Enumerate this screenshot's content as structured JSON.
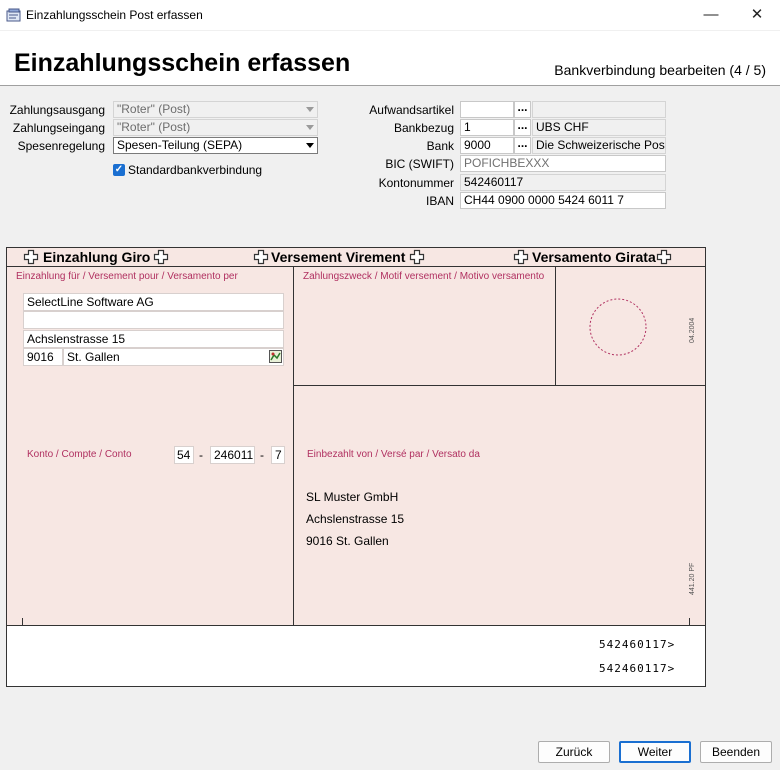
{
  "window": {
    "title": "Einzahlungsschein Post erfassen",
    "minimize": "—",
    "close": "✕"
  },
  "header": {
    "title": "Einzahlungsschein erfassen",
    "step": "Bankverbindung bearbeiten (4 / 5)"
  },
  "left_form": {
    "zahlungsausgang_label": "Zahlungsausgang",
    "zahlungsausgang_value": "\"Roter\" (Post)",
    "zahlungseingang_label": "Zahlungseingang",
    "zahlungseingang_value": "\"Roter\" (Post)",
    "spesen_label": "Spesenregelung",
    "spesen_value": "Spesen-Teilung (SEPA)",
    "standard_label": "Standardbankverbindung",
    "standard_checked": true
  },
  "right_form": {
    "aufwand_label": "Aufwandsartikel",
    "aufwand_value": "",
    "aufwand_desc": "",
    "bankbezug_label": "Bankbezug",
    "bankbezug_value": "1",
    "bankbezug_desc": "UBS CHF",
    "bank_label": "Bank",
    "bank_value": "9000",
    "bank_desc": "Die Schweizerische Post",
    "bic_label": "BIC (SWIFT)",
    "bic_value": "POFICHBEXXX",
    "konto_label": "Kontonummer",
    "konto_value": "542460117",
    "iban_label": "IBAN",
    "iban_value": "CH44 0900 0000 5424 6011 7",
    "dots": "..."
  },
  "slip": {
    "title_de": "Einzahlung Giro",
    "title_fr": "Versement Virement",
    "title_it": "Versamento Girata",
    "for_label": "Einzahlung für / Versement pour / Versamento per",
    "recipient_name": "SelectLine Software AG",
    "recipient_line2": "",
    "recipient_street": "Achslenstrasse 15",
    "recipient_zip": "9016",
    "recipient_city": "St. Gallen",
    "purpose_label": "Zahlungszweck / Motif versement / Motivo versamento",
    "stamp_code": "04.2004",
    "konto_label": "Konto / Compte / Conto",
    "konto_prefix": "54",
    "konto_main": "246011",
    "konto_check": "7",
    "dash": "-",
    "paid_by_label": "Einbezahlt von / Versé par / Versato da",
    "payer_name": "SL Muster GmbH",
    "payer_street": "Achslenstrasse 15",
    "payer_city": "9016 St. Gallen",
    "form_code": "441.20 PF",
    "code_line_1": "542460117>",
    "code_line_2": "542460117>"
  },
  "buttons": {
    "back": "Zurück",
    "next": "Weiter",
    "finish": "Beenden"
  },
  "colors": {
    "slip_bg": "#f7e7e3",
    "slip_text": "#b03060",
    "accent": "#1a6fd1"
  }
}
